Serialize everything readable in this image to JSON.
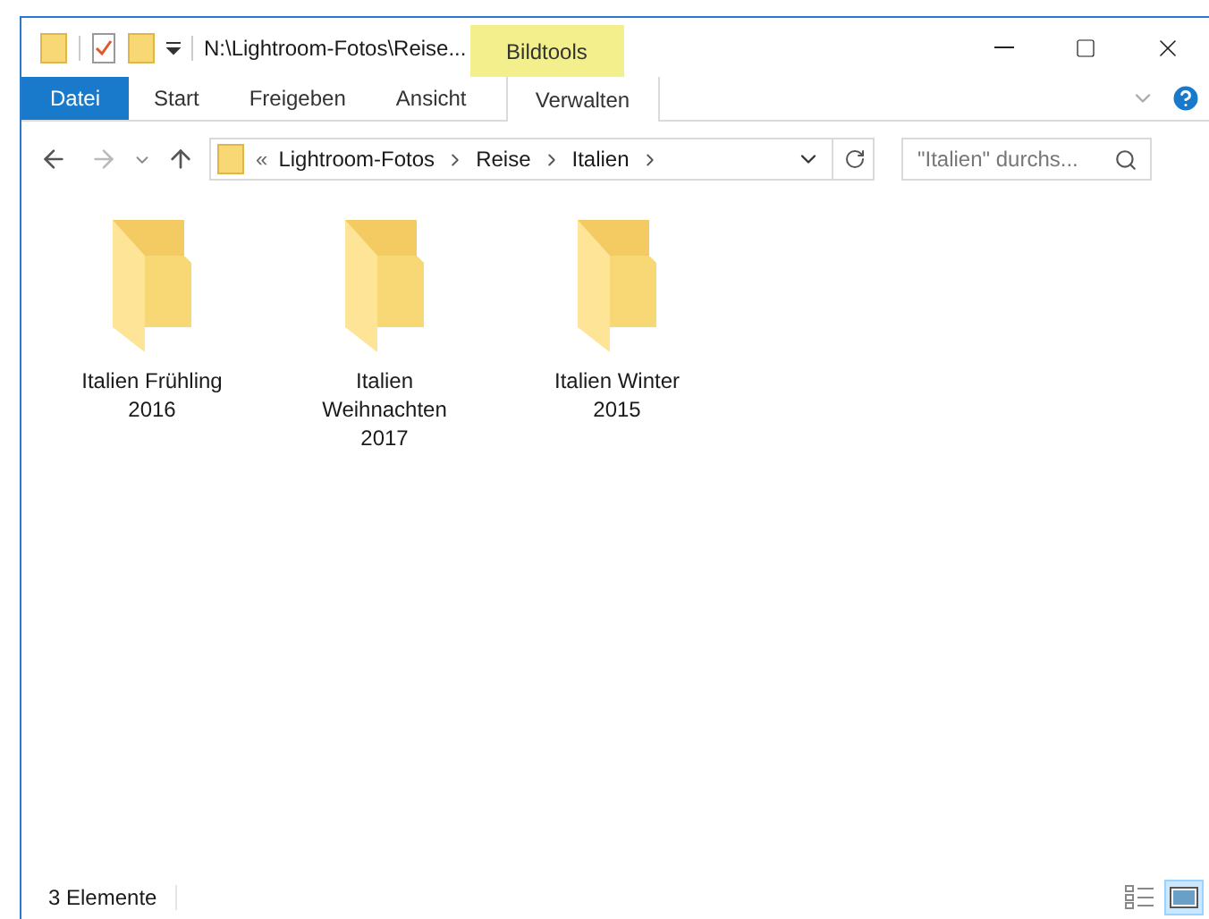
{
  "window": {
    "title": "N:\\Lightroom-Fotos\\Reise...",
    "contextual_group": "Bildtools"
  },
  "ribbon_tabs": [
    {
      "label": "Datei",
      "kind": "file"
    },
    {
      "label": "Start",
      "kind": "normal"
    },
    {
      "label": "Freigeben",
      "kind": "normal"
    },
    {
      "label": "Ansicht",
      "kind": "normal"
    },
    {
      "label": "Verwalten",
      "kind": "contextual"
    }
  ],
  "address_bar": {
    "overflow": "«",
    "path": [
      "Lightroom-Fotos",
      "Reise",
      "Italien"
    ]
  },
  "search": {
    "placeholder": "\"Italien\" durchs..."
  },
  "folders": [
    {
      "name": "Italien Frühling 2016"
    },
    {
      "name": "Italien Weihnachten 2017"
    },
    {
      "name": "Italien Winter 2015"
    }
  ],
  "status_bar": {
    "count": "3 Elemente"
  },
  "views": [
    {
      "kind": "details",
      "selected": false
    },
    {
      "kind": "large-icons",
      "selected": true
    }
  ]
}
